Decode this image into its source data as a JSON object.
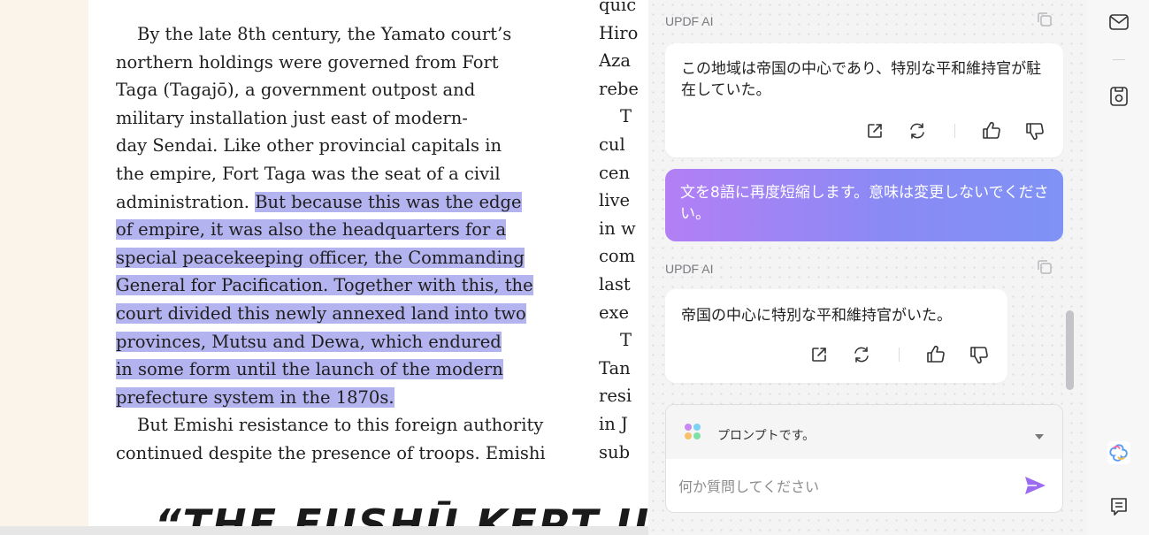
{
  "document": {
    "column_left": [
      "By the late 8th century, the Yamato court’s",
      "northern holdings were governed from Fort",
      "Taga (Tagajō), a government outpost and",
      "military installation just east of modern-",
      "day Sendai. Like other provincial capitals in",
      "the empire, Fort Taga was the seat of a civil",
      "administration. ",
      "But because this was the edge",
      "of empire, it was also the headquarters for a",
      "special peacekeeping officer, the Commanding",
      "General for Pacification. Together with this, the",
      "court divided this newly annexed land into two",
      "provinces, Mutsu and Dewa, which endured",
      "in some form until the launch of the modern",
      "prefecture system in the 1870s.",
      "But Emishi resistance to this foreign authority",
      "continued despite the presence of troops. Emishi"
    ],
    "column_right": [
      "quic",
      "Hiro",
      "Aza",
      "rebe",
      "T",
      "cul",
      "cen",
      "live",
      "in w",
      "com",
      "last",
      "exe",
      "T",
      "Tan",
      "resi",
      "in J",
      "sub"
    ],
    "heading_fragment": "“THE FUSHŪ KEPT UP"
  },
  "ai_panel": {
    "label": "UPDF AI",
    "messages": [
      {
        "role": "ai",
        "text": "この地域は帝国の中心であり、特別な平和維持官が駐在していた。"
      },
      {
        "role": "user",
        "text": "文を8語に再度短縮します。意味は変更しないでください。"
      },
      {
        "role": "ai",
        "text": "帝国の中心に特別な平和維持官がいた。"
      }
    ],
    "prompt_label": "プロンプトです。",
    "input_placeholder": "何か質問してください",
    "colors": {
      "user_gradient_start": "#b37ff5",
      "user_gradient_end": "#7f92f5",
      "send_icon": "#9b6cf2",
      "highlight": "#b3b3ef"
    }
  },
  "right_rail": {
    "icons": [
      "mail-icon",
      "save-icon",
      "updf-ai-logo-icon",
      "comment-icon"
    ]
  }
}
